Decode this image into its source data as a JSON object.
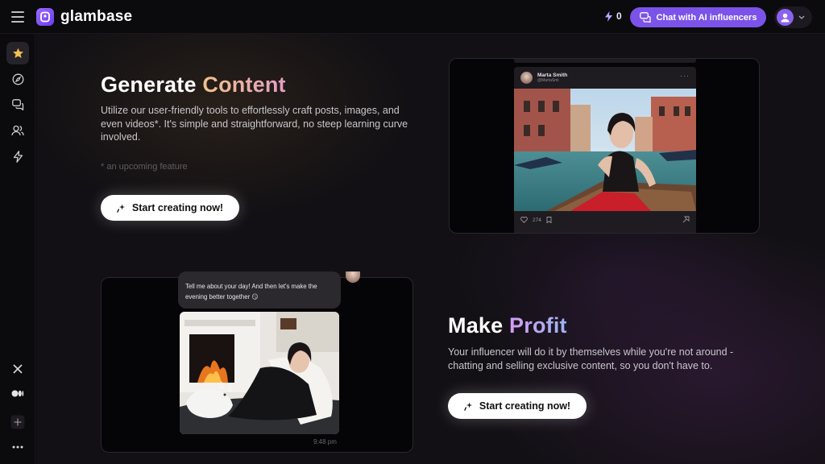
{
  "app": {
    "name": "glambase",
    "credits": "0",
    "chat_button_label": "Chat with AI influencers"
  },
  "sidebar": {
    "items": [
      {
        "icon": "star-icon",
        "active": true
      },
      {
        "icon": "compass-icon",
        "active": false
      },
      {
        "icon": "chat-bubbles-icon",
        "active": false
      },
      {
        "icon": "users-icon",
        "active": false
      },
      {
        "icon": "lightning-icon",
        "active": false
      }
    ],
    "bottom": [
      "x-logo-icon",
      "medium-logo-icon",
      "plus-icon",
      "more-icon"
    ]
  },
  "section_generate": {
    "title_white": "Generate",
    "title_accent": "Content",
    "description": "Utilize our user-friendly tools to effortlessly craft posts, images, and even videos*. It's simple and straightforward, no steep learning curve involved.",
    "note": "* an upcoming feature",
    "cta_label": "Start creating now!"
  },
  "post_preview": {
    "author_name": "Marta Smith",
    "author_handle": "@MartaSmi",
    "likes": "274"
  },
  "section_profit": {
    "title_white": "Make",
    "title_accent": "Profit",
    "description": "Your influencer will do it by themselves while you're not around - chatting and selling exclusive content, so you don't have to.",
    "cta_label": "Start creating now!"
  },
  "chat_preview": {
    "message": "Tell me about your day! And then let's make the evening better together 😏",
    "time": "9:48 pm"
  },
  "colors": {
    "brand": "#7b53e8",
    "accent_gold": "#f1c18a",
    "accent_purple": "#d39cf2"
  }
}
